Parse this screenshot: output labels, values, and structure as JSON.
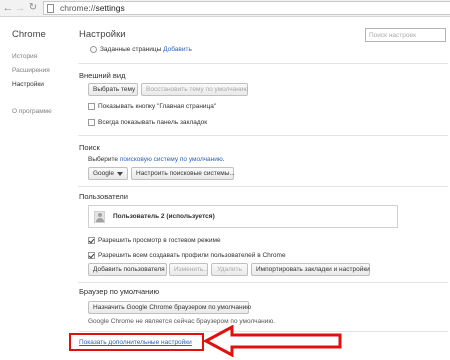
{
  "browser": {
    "url_scheme": "chrome://",
    "url_host": "settings"
  },
  "sidebar": {
    "title": "Chrome",
    "items": [
      {
        "label": "История"
      },
      {
        "label": "Расширения"
      },
      {
        "label": "Настройки"
      },
      {
        "label": "О программе"
      }
    ]
  },
  "header": {
    "title": "Настройки",
    "search_placeholder": "Поиск настроек"
  },
  "startup": {
    "radio_label": "Заданные страницы",
    "add_link": "Добавить"
  },
  "appearance": {
    "title": "Внешний вид",
    "select_theme": "Выбрать тему",
    "reset_theme": "Восстановить тему по умолчанию",
    "show_home_button": "Показывать кнопку \"Главная страница\"",
    "show_bookmarks_bar": "Всегда показывать панель закладок"
  },
  "search": {
    "title": "Поиск",
    "desc_prefix": "Выберите",
    "desc_link": "поисковую систему по умолчанию",
    "desc_suffix": ".",
    "engine_selected": "Google",
    "manage_engines": "Настроить поисковые системы..."
  },
  "users": {
    "title": "Пользователи",
    "profile_name": "Пользователь 2 (используется)",
    "guest_browsing": "Разрешить просмотр в гостевом режиме",
    "allow_add_profiles": "Разрешить всем создавать профили пользователей в Chrome",
    "add_user": "Добавить пользователя",
    "edit": "Изменить...",
    "delete": "Удалить",
    "import": "Импортировать закладки и настройки"
  },
  "default_browser": {
    "title": "Браузер по умолчанию",
    "make_default": "Назначить Google Chrome браузером по умолчанию",
    "status": "Google Chrome не является сейчас браузером по умолчанию."
  },
  "advanced": {
    "link": "Показать дополнительные настройки"
  },
  "colors": {
    "link": "#2a62b8",
    "annotation": "#e01010"
  }
}
